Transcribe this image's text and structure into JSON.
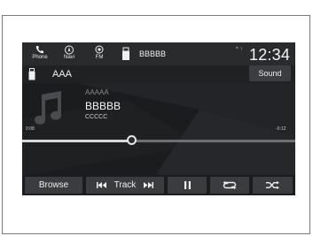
{
  "topbar": {
    "phone_label": "Phone",
    "navi_label": "Navi",
    "fm_label": "FM",
    "source_title": "BBBBB",
    "status": "^ ↑",
    "clock": "12:34"
  },
  "subheader": {
    "source_name": "AAA",
    "sound_label": "Sound"
  },
  "now_playing": {
    "artist": "AAAAA",
    "track": "BBBBB",
    "album": "CCCCC",
    "elapsed": "0:08",
    "remaining": "-0:12",
    "progress": 0.4
  },
  "controls": {
    "browse_label": "Browse",
    "track_label": "Track"
  },
  "colors": {
    "background": "#1b1c1e",
    "button": "#3b3c3f",
    "text": "#f0f0f0"
  },
  "icons": [
    "phone-icon",
    "navi-icon",
    "fm-icon",
    "usb-icon",
    "music-note-icon",
    "skip-back-icon",
    "skip-forward-icon",
    "pause-icon",
    "repeat-icon",
    "shuffle-icon"
  ]
}
